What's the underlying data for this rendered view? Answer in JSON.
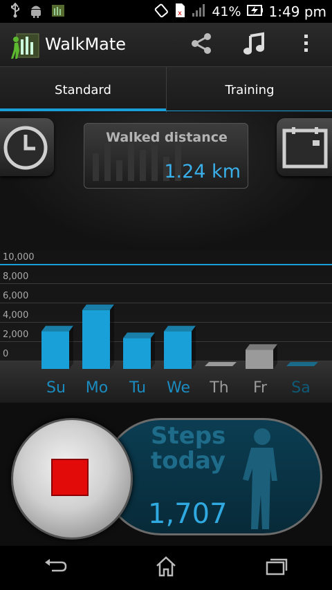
{
  "status_bar": {
    "battery_percent": "41%",
    "time": "1:49 pm",
    "icons": [
      "usb-icon",
      "android-debug-icon",
      "app-notification-icon",
      "rotation-icon",
      "sim-icon",
      "signal-icon",
      "battery-charging-icon"
    ]
  },
  "action_bar": {
    "title": "WalkMate",
    "actions": [
      "share-icon",
      "music-icon",
      "overflow-menu-icon"
    ]
  },
  "tabs": [
    {
      "label": "Standard",
      "selected": true
    },
    {
      "label": "Training",
      "selected": false
    }
  ],
  "distance_widget": {
    "label": "Walked distance",
    "value": "1.24 km"
  },
  "chart_data": {
    "type": "bar",
    "categories": [
      "Su",
      "Mo",
      "Tu",
      "We",
      "Th",
      "Fr",
      "Sa"
    ],
    "values": [
      3600,
      5800,
      2900,
      3600,
      0,
      1700,
      0
    ],
    "ylim": [
      0,
      10000
    ],
    "yticks": [
      "0",
      "2,000",
      "4,000",
      "6,000",
      "8,000",
      "10,000"
    ],
    "goal_value": 10000,
    "bar_colors": [
      "#1aa0d8",
      "#1aa0d8",
      "#1aa0d8",
      "#1aa0d8",
      "#9a9a9a",
      "#9a9a9a",
      "#1a6a8a"
    ],
    "label_colors": [
      "#1a8cc0",
      "#1a8cc0",
      "#1a8cc0",
      "#1a8cc0",
      "#9a9a9a",
      "#9a9a9a",
      "#0e5a78"
    ],
    "grid": true
  },
  "steps_panel": {
    "label": "Steps today",
    "count": "1,707"
  },
  "colors": {
    "accent": "#1aa0d8",
    "stop": "#e30a0a"
  },
  "nav_bar": [
    "back-icon",
    "home-icon",
    "recent-apps-icon"
  ]
}
